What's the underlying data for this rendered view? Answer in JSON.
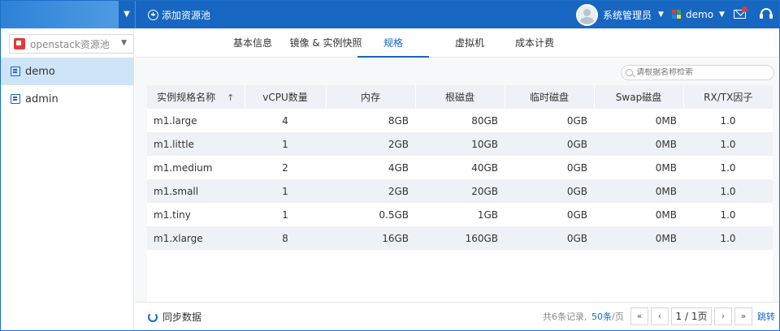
{
  "header": {
    "add_pool_label": "添加资源池",
    "user_name": "系统管理员",
    "project_name": "demo",
    "brand_colors": [
      "#e53935",
      "#43a047",
      "#1e88e5",
      "#fdd835"
    ]
  },
  "sidebar": {
    "pool_select": "openstack资源池",
    "items": [
      {
        "label": "demo",
        "active": true
      },
      {
        "label": "admin",
        "active": false
      }
    ]
  },
  "tabs": [
    {
      "label": "基本信息"
    },
    {
      "label": "镜像 & 实例快照"
    },
    {
      "label": "规格"
    },
    {
      "label": "虚拟机"
    },
    {
      "label": "成本计费"
    }
  ],
  "search": {
    "placeholder": "请根据名称检索"
  },
  "table": {
    "headers": [
      "实例规格名称",
      "vCPU数量",
      "内存",
      "根磁盘",
      "临时磁盘",
      "Swap磁盘",
      "RX/TX因子"
    ],
    "sort_indicator": "↑",
    "rows": [
      [
        "m1.large",
        "4",
        "8GB",
        "80GB",
        "0GB",
        "0MB",
        "1.0"
      ],
      [
        "m1.little",
        "1",
        "2GB",
        "10GB",
        "0GB",
        "0MB",
        "1.0"
      ],
      [
        "m1.medium",
        "2",
        "4GB",
        "40GB",
        "0GB",
        "0MB",
        "1.0"
      ],
      [
        "m1.small",
        "1",
        "2GB",
        "20GB",
        "0GB",
        "0MB",
        "1.0"
      ],
      [
        "m1.tiny",
        "1",
        "0.5GB",
        "1GB",
        "0GB",
        "0MB",
        "1.0"
      ],
      [
        "m1.xlarge",
        "8",
        "16GB",
        "160GB",
        "0GB",
        "0MB",
        "1.0"
      ]
    ]
  },
  "footer": {
    "sync_label": "同步数据",
    "total_text": "共6条记录,",
    "per_page": "50条",
    "per_page_unit": "/页",
    "first": "«",
    "prev": "‹",
    "page_info": "1 / 1页",
    "next": "›",
    "last": "»",
    "jump": "跳转"
  },
  "colors": {
    "accent": "#1767c2",
    "active_row": "#cfe4f7"
  }
}
